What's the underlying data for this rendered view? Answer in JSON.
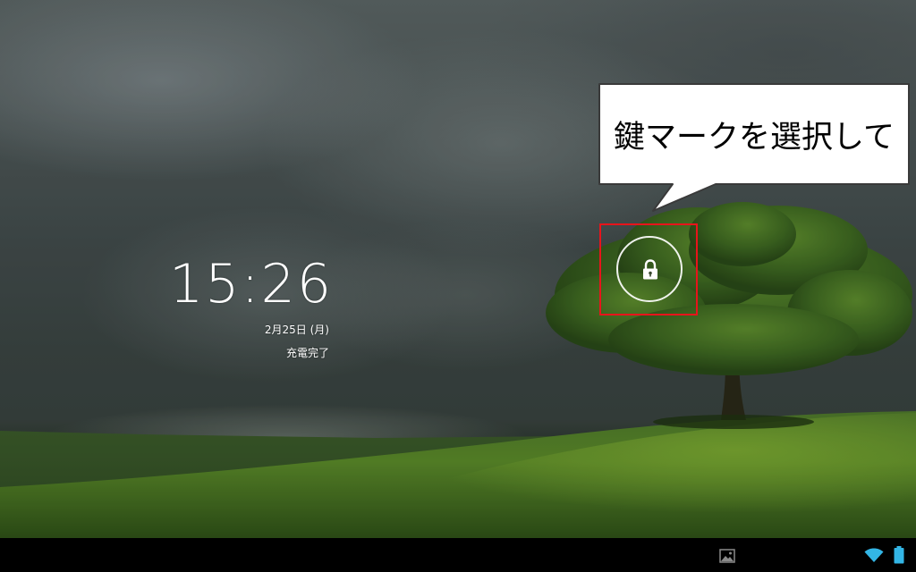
{
  "lockscreen": {
    "time": "15:26",
    "date": "2月25日 (月)",
    "charge_status": "充電完了"
  },
  "annotation": {
    "callout_text": "鍵マークを選択して",
    "highlight_color": "#e8141b"
  },
  "unlock": {
    "icon": "lock-icon"
  },
  "status_bar": {
    "icons": [
      "gallery-icon",
      "wifi-icon",
      "battery-icon"
    ],
    "accent_color": "#33b5e5"
  }
}
